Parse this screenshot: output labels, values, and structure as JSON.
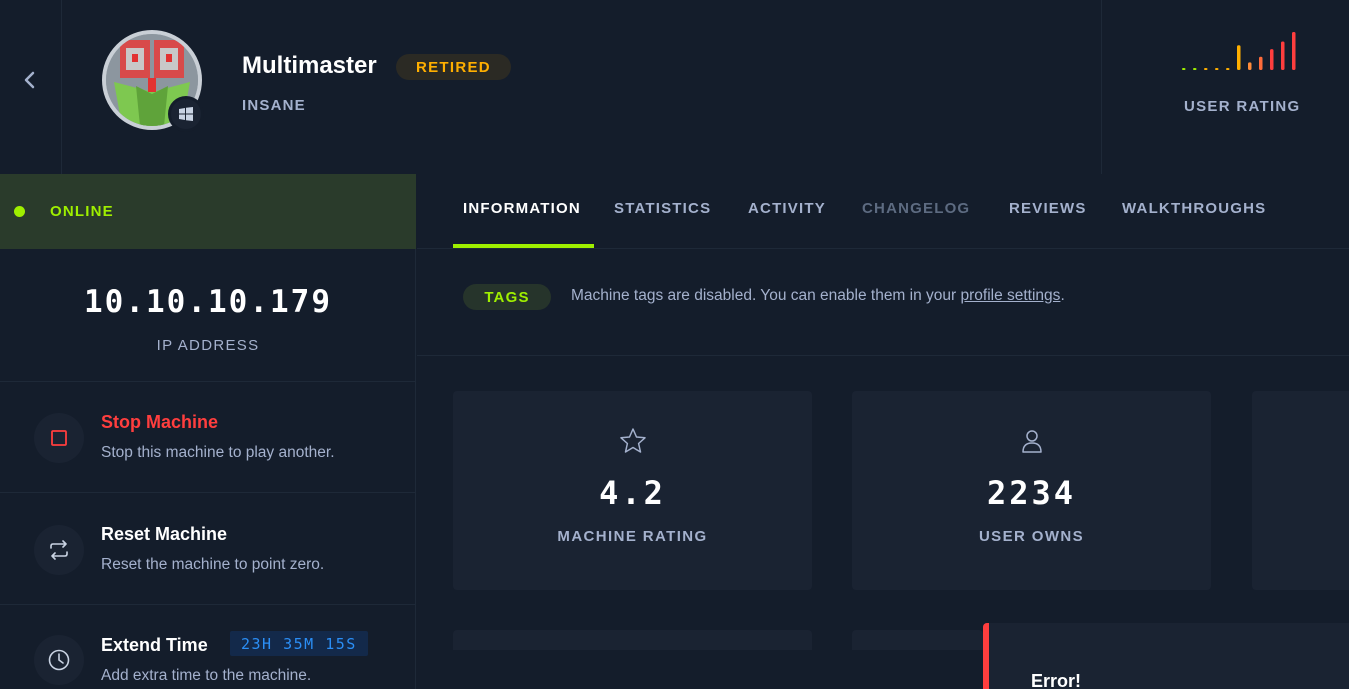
{
  "machine": {
    "name": "Multimaster",
    "status_badge": "RETIRED",
    "difficulty": "INSANE",
    "os": "windows"
  },
  "user_rating": {
    "label": "USER RATING",
    "bars": [
      {
        "level": 0.05,
        "color": "#9fef00"
      },
      {
        "level": 0.05,
        "color": "#9fef00"
      },
      {
        "level": 0.05,
        "color": "#ffaf00"
      },
      {
        "level": 0.05,
        "color": "#ffaf00"
      },
      {
        "level": 0.05,
        "color": "#ffaf00"
      },
      {
        "level": 0.65,
        "color": "#ffaf00"
      },
      {
        "level": 0.2,
        "color": "#ff8c3a"
      },
      {
        "level": 0.35,
        "color": "#ff6b3a"
      },
      {
        "level": 0.55,
        "color": "#ff3e3e"
      },
      {
        "level": 0.75,
        "color": "#ff3e3e"
      },
      {
        "level": 1.0,
        "color": "#ff3e3e"
      }
    ]
  },
  "connection": {
    "status": "ONLINE",
    "ip": "10.10.10.179",
    "ip_label": "IP ADDRESS"
  },
  "actions": {
    "stop": {
      "title": "Stop Machine",
      "desc": "Stop this machine to play another."
    },
    "reset": {
      "title": "Reset Machine",
      "desc": "Reset the machine to point zero."
    },
    "extend": {
      "title": "Extend Time",
      "desc": "Add extra time to the machine.",
      "timer": "23H 35M 15S"
    }
  },
  "tabs": [
    {
      "label": "INFORMATION",
      "state": "active"
    },
    {
      "label": "STATISTICS",
      "state": "normal"
    },
    {
      "label": "ACTIVITY",
      "state": "normal"
    },
    {
      "label": "CHANGELOG",
      "state": "disabled"
    },
    {
      "label": "REVIEWS",
      "state": "normal"
    },
    {
      "label": "WALKTHROUGHS",
      "state": "normal"
    }
  ],
  "tags": {
    "pill": "TAGS",
    "message": "Machine tags are disabled. You can enable them in your ",
    "link": "profile settings",
    "suffix": "."
  },
  "stats": {
    "rating": {
      "value": "4.2",
      "label": "MACHINE RATING",
      "icon": "star-icon"
    },
    "owns": {
      "value": "2234",
      "label": "USER OWNS",
      "icon": "user-icon"
    }
  },
  "toast": {
    "title": "Error!"
  },
  "colors": {
    "accent": "#9fef00",
    "danger": "#ff3e3e",
    "warning": "#ffaf00",
    "background": "#141d2b",
    "card": "#1a2332"
  }
}
